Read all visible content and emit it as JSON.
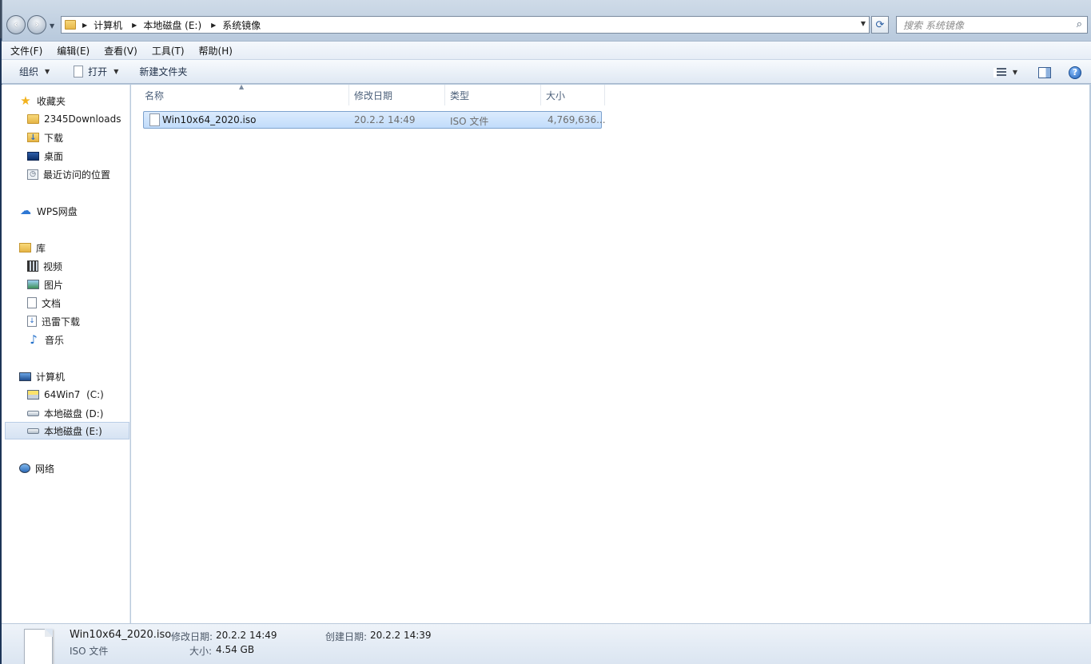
{
  "address": {
    "crumbs": [
      "计算机",
      "本地磁盘 (E:)",
      "系统镜像"
    ]
  },
  "search": {
    "placeholder": "搜索 系统镜像"
  },
  "menu": [
    "文件(F)",
    "编辑(E)",
    "查看(V)",
    "工具(T)",
    "帮助(H)"
  ],
  "commands": {
    "organize": "组织",
    "open": "打开",
    "new_folder": "新建文件夹"
  },
  "nav": {
    "favorites": "收藏夹",
    "fav_items": [
      "2345Downloads",
      "下载",
      "桌面",
      "最近访问的位置"
    ],
    "wps": "WPS网盘",
    "library": "库",
    "lib_items": [
      "视频",
      "图片",
      "文档",
      "迅雷下载",
      "音乐"
    ],
    "computer": "计算机",
    "drives": [
      "64Win7  (C:)",
      "本地磁盘 (D:)",
      "本地磁盘 (E:)"
    ],
    "network": "网络"
  },
  "columns": {
    "name": "名称",
    "modified": "修改日期",
    "type": "类型",
    "size": "大小"
  },
  "files": [
    {
      "name": "Win10x64_2020.iso",
      "modified": "20.2.2 14:49",
      "type": "ISO 文件",
      "size": "4,769,636..."
    }
  ],
  "details": {
    "filename": "Win10x64_2020.iso",
    "filetype": "ISO 文件",
    "modified_label": "修改日期:",
    "modified": "20.2.2 14:49",
    "created_label": "创建日期:",
    "created": "20.2.2 14:39",
    "size_label": "大小:",
    "size": "4.54 GB"
  }
}
